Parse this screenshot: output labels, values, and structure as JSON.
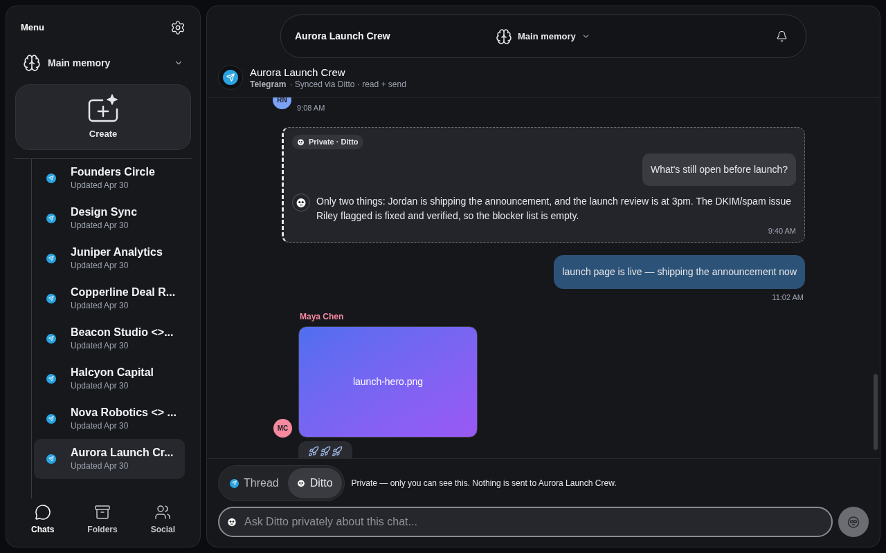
{
  "sidebar": {
    "title": "Menu",
    "memory": "Main memory",
    "create": "Create",
    "chats": [
      {
        "name": "Founders Circle",
        "subtitle": "Updated Apr 30",
        "selected": false
      },
      {
        "name": "Design Sync",
        "subtitle": "Updated Apr 30",
        "selected": false
      },
      {
        "name": "Juniper Analytics",
        "subtitle": "Updated Apr 30",
        "selected": false
      },
      {
        "name": "Copperline Deal R...",
        "subtitle": "Updated Apr 30",
        "selected": false
      },
      {
        "name": "Beacon Studio <>...",
        "subtitle": "Updated Apr 30",
        "selected": false
      },
      {
        "name": "Halcyon Capital",
        "subtitle": "Updated Apr 30",
        "selected": false
      },
      {
        "name": "Nova Robotics <> ...",
        "subtitle": "Updated Apr 30",
        "selected": false
      },
      {
        "name": "Aurora Launch Cr...",
        "subtitle": "Updated Apr 30",
        "selected": true
      }
    ],
    "nav": [
      {
        "label": "Chats",
        "kind": "chats",
        "selected": true
      },
      {
        "label": "Folders",
        "kind": "folders",
        "selected": false
      },
      {
        "label": "Social",
        "kind": "social",
        "selected": false
      }
    ]
  },
  "header": {
    "title": "Aurora Launch Crew",
    "memory": "Main memory"
  },
  "chat_header": {
    "title": "Aurora Launch Crew",
    "platform": "Telegram",
    "meta": "· Synced via Ditto · read + send"
  },
  "messages": [
    {
      "kind": "tail",
      "avatar": "RN",
      "color": "#7aa2f7",
      "time": "9:08 AM"
    },
    {
      "kind": "ditto",
      "badge": "Private · Ditto",
      "question": "What's still open before launch?",
      "answer": "Only two things: Jordan is shipping the announcement, and the launch review is at 3pm. The DKIM/spam issue Riley flagged is fixed and verified, so the blocker list is empty.",
      "time": "9:40 AM"
    },
    {
      "kind": "outgoing",
      "text": "launch page is live — shipping the announcement now",
      "time": "11:02 AM"
    },
    {
      "kind": "image",
      "sender": "Maya Chen",
      "avatar": "MC",
      "color": "#f4899f",
      "filename": "launch-hero.png"
    },
    {
      "kind": "rockets"
    }
  ],
  "composer": {
    "modes": [
      {
        "label": "Thread",
        "kind": "thread",
        "selected": false
      },
      {
        "label": "Ditto",
        "kind": "ditto",
        "selected": true
      }
    ],
    "note": "Private — only you can see this. Nothing is sent to Aurora Launch Crew.",
    "placeholder": "Ask Ditto privately about this chat..."
  }
}
